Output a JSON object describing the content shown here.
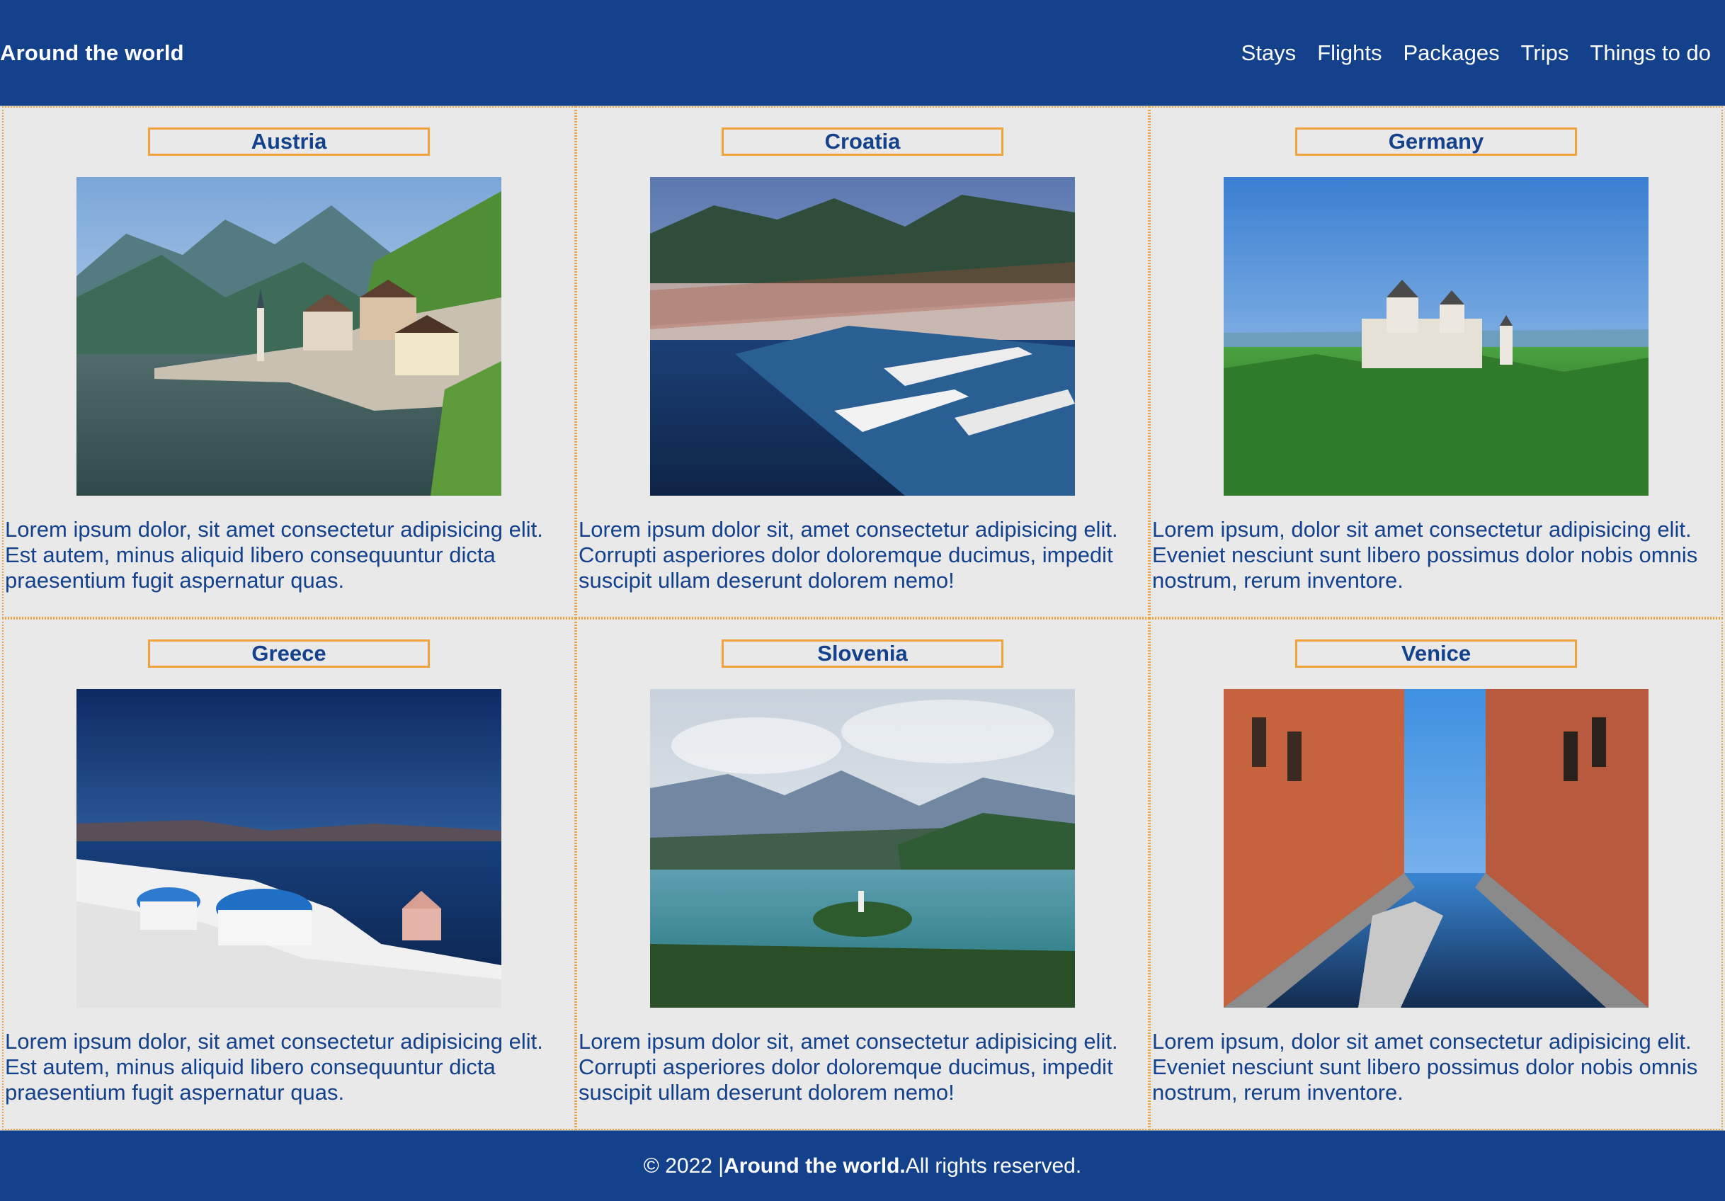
{
  "brand": "Around the world",
  "nav": [
    {
      "label": "Stays"
    },
    {
      "label": "Flights"
    },
    {
      "label": "Packages"
    },
    {
      "label": "Trips"
    },
    {
      "label": "Things to do"
    }
  ],
  "cards": [
    {
      "title": "Austria",
      "desc": "Lorem ipsum dolor, sit amet consectetur adipisicing elit. Est autem, minus aliquid libero consequuntur dicta praesentium fugit aspernatur quas."
    },
    {
      "title": "Croatia",
      "desc": "Lorem ipsum dolor sit, amet consectetur adipisicing elit. Corrupti asperiores dolor doloremque ducimus, impedit suscipit ullam deserunt dolorem nemo!"
    },
    {
      "title": "Germany",
      "desc": "Lorem ipsum, dolor sit amet consectetur adipisicing elit. Eveniet nesciunt sunt libero possimus dolor nobis omnis nostrum, rerum inventore."
    },
    {
      "title": "Greece",
      "desc": "Lorem ipsum dolor, sit amet consectetur adipisicing elit. Est autem, minus aliquid libero consequuntur dicta praesentium fugit aspernatur quas."
    },
    {
      "title": "Slovenia",
      "desc": "Lorem ipsum dolor sit, amet consectetur adipisicing elit. Corrupti asperiores dolor doloremque ducimus, impedit suscipit ullam deserunt dolorem nemo!"
    },
    {
      "title": "Venice",
      "desc": "Lorem ipsum, dolor sit amet consectetur adipisicing elit. Eveniet nesciunt sunt libero possimus dolor nobis omnis nostrum, rerum inventore."
    }
  ],
  "footer": {
    "copyright": "© 2022 | ",
    "brand": "Around the world.",
    "rights": " All rights reserved."
  },
  "colors": {
    "brand_blue": "#13418c",
    "accent_orange": "#f0a33b",
    "background": "#e9e9e9"
  }
}
